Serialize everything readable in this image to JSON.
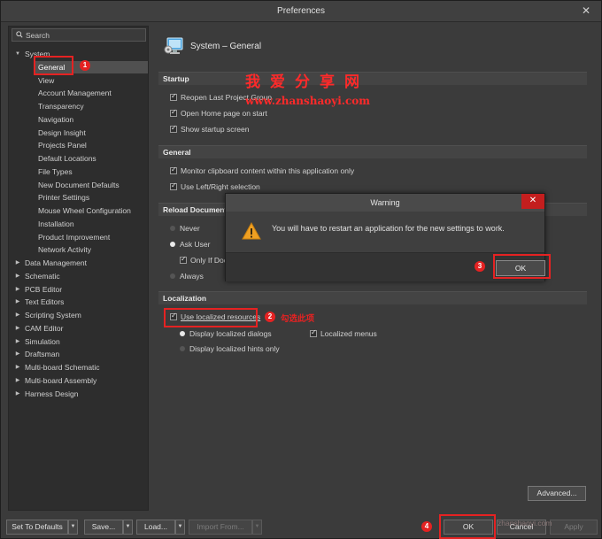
{
  "window": {
    "title": "Preferences",
    "close_glyph": "✕"
  },
  "sidebar": {
    "search_placeholder": "Search",
    "tree": [
      {
        "label": "System",
        "level": 0,
        "expanded": true
      },
      {
        "label": "General",
        "level": 1,
        "selected": true
      },
      {
        "label": "View",
        "level": 1
      },
      {
        "label": "Account Management",
        "level": 1
      },
      {
        "label": "Transparency",
        "level": 1
      },
      {
        "label": "Navigation",
        "level": 1
      },
      {
        "label": "Design Insight",
        "level": 1
      },
      {
        "label": "Projects Panel",
        "level": 1
      },
      {
        "label": "Default Locations",
        "level": 1
      },
      {
        "label": "File Types",
        "level": 1
      },
      {
        "label": "New Document Defaults",
        "level": 1
      },
      {
        "label": "Printer Settings",
        "level": 1
      },
      {
        "label": "Mouse Wheel Configuration",
        "level": 1
      },
      {
        "label": "Installation",
        "level": 1
      },
      {
        "label": "Product Improvement",
        "level": 1
      },
      {
        "label": "Network Activity",
        "level": 1
      },
      {
        "label": "Data Management",
        "level": 0
      },
      {
        "label": "Schematic",
        "level": 0
      },
      {
        "label": "PCB Editor",
        "level": 0
      },
      {
        "label": "Text Editors",
        "level": 0
      },
      {
        "label": "Scripting System",
        "level": 0
      },
      {
        "label": "CAM Editor",
        "level": 0
      },
      {
        "label": "Simulation",
        "level": 0
      },
      {
        "label": "Draftsman",
        "level": 0
      },
      {
        "label": "Multi-board Schematic",
        "level": 0
      },
      {
        "label": "Multi-board Assembly",
        "level": 0
      },
      {
        "label": "Harness Design",
        "level": 0
      }
    ]
  },
  "main": {
    "page_title": "System – General",
    "startup": {
      "title": "Startup",
      "reopen": "Reopen Last Project Group",
      "open_home": "Open Home page on start",
      "show_splash": "Show startup screen"
    },
    "general": {
      "title": "General",
      "monitor": "Monitor clipboard content within this application only",
      "left_right": "Use Left/Right selection"
    },
    "reload": {
      "title": "Reload Document",
      "never": "Never",
      "ask": "Ask User",
      "only_if": "Only If Doc",
      "always": "Always"
    },
    "localization": {
      "title": "Localization",
      "use_localized": "Use localized resources",
      "display_dialogs": "Display localized dialogs",
      "localized_menus": "Localized menus",
      "display_hints": "Display localized hints only"
    },
    "advanced_label": "Advanced..."
  },
  "dialog": {
    "title": "Warning",
    "close_glyph": "✕",
    "message": "You will have to restart an application for the new settings to work.",
    "ok_label": "OK"
  },
  "bottom": {
    "set_defaults": "Set To Defaults",
    "save": "Save...",
    "load": "Load...",
    "import_from": "Import From...",
    "ok": "OK",
    "cancel": "Cancel",
    "apply": "Apply"
  },
  "annotations": {
    "n1": "1",
    "n2": "2",
    "n3": "3",
    "n4": "4",
    "check_this": "勾选此项"
  },
  "watermark": {
    "line1": "我爱分享网",
    "line2": "www.zhanshaoyi.com",
    "bottom": "zhanshaoyi.com"
  },
  "colors": {
    "accent_red": "#e52222",
    "dialog_close": "#c41e1e"
  }
}
